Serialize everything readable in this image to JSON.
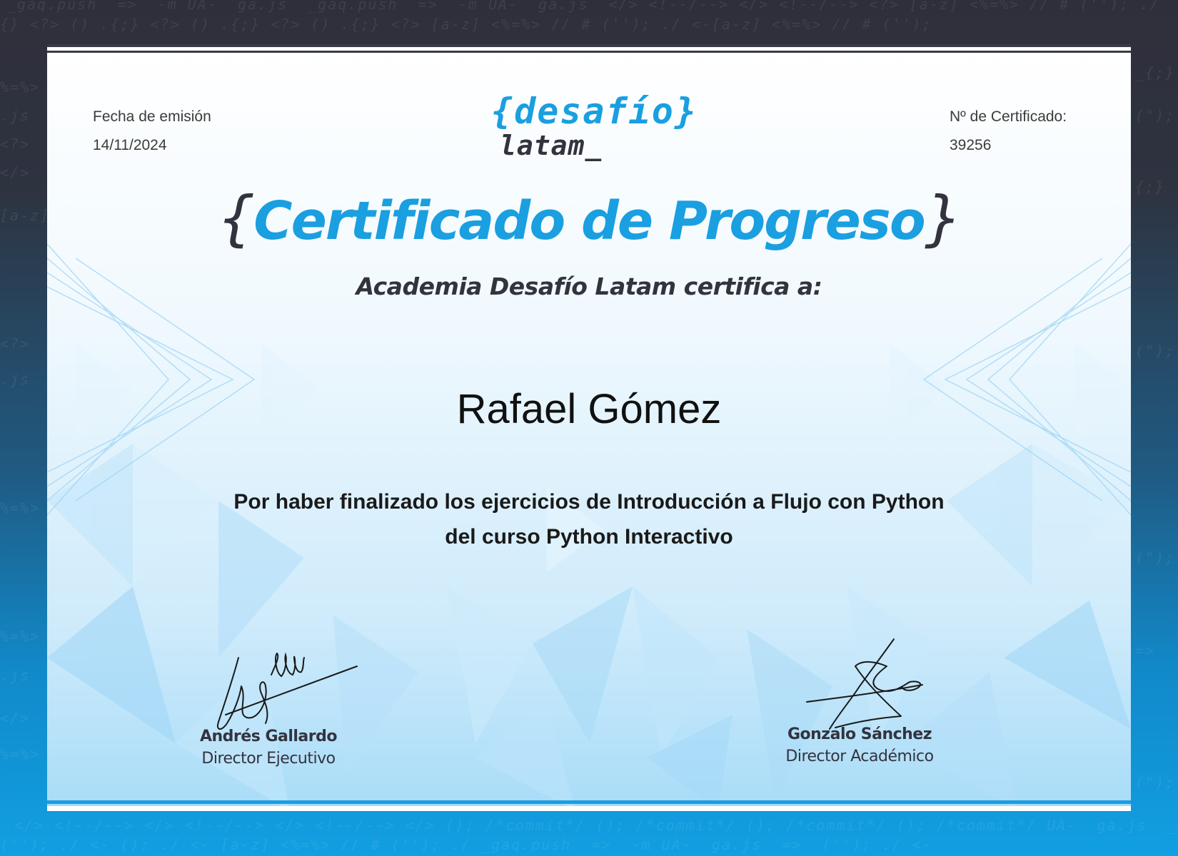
{
  "header": {
    "issue_date_label": "Fecha de emisión",
    "issue_date": "14/11/2024",
    "certificate_number_label": "Nº de Certificado:",
    "certificate_number": "39256"
  },
  "logo": {
    "line1": "{desafío}",
    "line2": "latam_"
  },
  "title": {
    "open_brace": "{",
    "text": "Certificado de Progreso",
    "close_brace": "}"
  },
  "certifies_line": "Academia Desafío Latam certifica a:",
  "recipient_name": "Rafael Gómez",
  "description": {
    "line1": "Por haber finalizado los ejercicios de Introducción a Flujo con Python",
    "line2": "del curso Python Interactivo"
  },
  "signatures": [
    {
      "name": "Andrés Gallardo",
      "role": "Director Ejecutivo"
    },
    {
      "name": "Gonzalo Sánchez",
      "role": "Director Académico"
    }
  ],
  "colors": {
    "brand_blue": "#1a9fe0",
    "dark": "#33333f",
    "frame_top": "#2f2f3b",
    "frame_bottom": "#119fe2"
  }
}
